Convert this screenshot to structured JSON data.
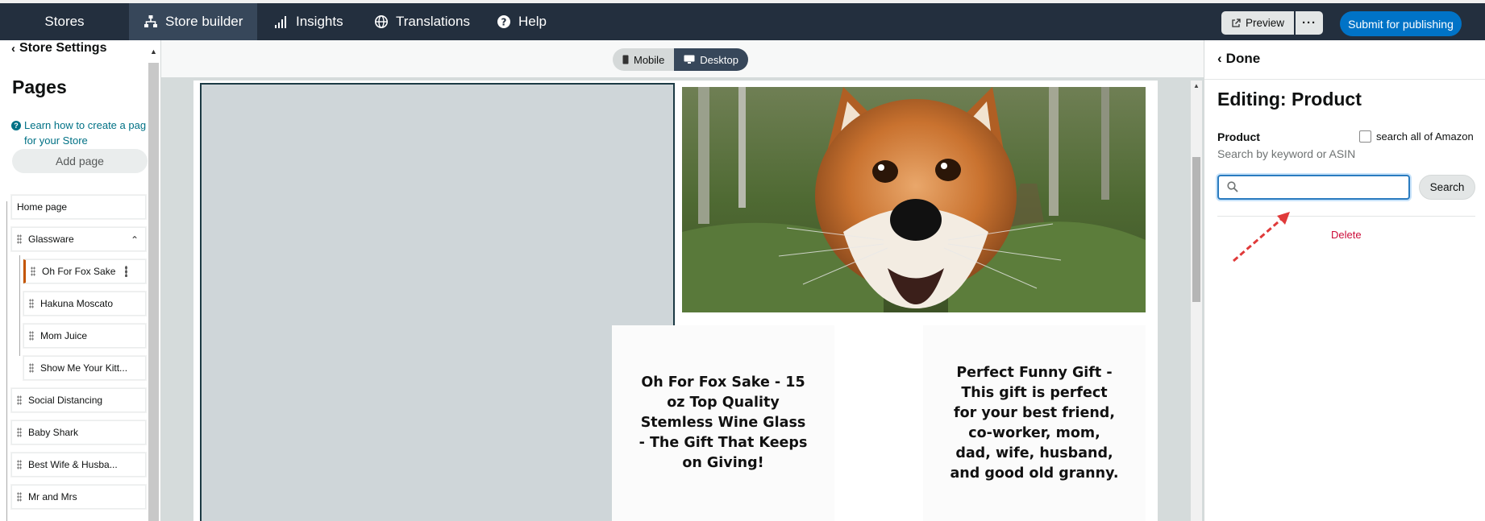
{
  "topbar": {
    "brand": "Stores",
    "tabs": [
      {
        "label": "Store builder",
        "icon": "sitemap-icon"
      },
      {
        "label": "Insights",
        "icon": "bar-chart-icon"
      },
      {
        "label": "Translations",
        "icon": "globe-icon"
      },
      {
        "label": "Help",
        "icon": "help-icon"
      }
    ],
    "preview_label": "Preview",
    "more_label": "···",
    "submit_label": "Submit for publishing"
  },
  "sidebar": {
    "back_label": "Store Settings",
    "title": "Pages",
    "learn_link": "Learn how to create a page for your Store",
    "learn_line1": "Learn how to create a pag",
    "learn_line2": "for your Store",
    "add_page_label": "Add page",
    "pages": [
      {
        "label": "Home page"
      },
      {
        "label": "Glassware",
        "expanded": true
      },
      {
        "label": "Oh For Fox Sake",
        "selected": true
      },
      {
        "label": "Hakuna Moscato"
      },
      {
        "label": "Mom Juice"
      },
      {
        "label": "Show Me Your Kitt..."
      },
      {
        "label": "Social Distancing"
      },
      {
        "label": "Baby Shark"
      },
      {
        "label": "Best Wife & Husba..."
      },
      {
        "label": "Mr and Mrs"
      }
    ]
  },
  "canvas": {
    "view_toggle": {
      "mobile_label": "Mobile",
      "desktop_label": "Desktop",
      "selected": "Desktop"
    },
    "tiles": [
      {
        "text": "Oh For Fox Sake - 15 oz Top Quality Stemless Wine Glass - The Gift That Keeps on Giving!"
      },
      {
        "text": "Perfect Funny Gift - This gift is perfect for your best friend, co-worker, mom, dad, wife, husband, and good old granny."
      }
    ]
  },
  "editor": {
    "done_label": "Done",
    "title": "Editing: Product",
    "product_label": "Product",
    "search_all_label": "search all of Amazon",
    "search_all_checked": false,
    "hint": "Search by keyword or ASIN",
    "search_value": "",
    "search_button": "Search",
    "delete_label": "Delete"
  },
  "colors": {
    "nav_bg": "#232f3e",
    "accent": "#0073c7",
    "selected_page": "#c45500",
    "delete": "#cc0c39",
    "annotation_arrow": "#e03a3a"
  }
}
